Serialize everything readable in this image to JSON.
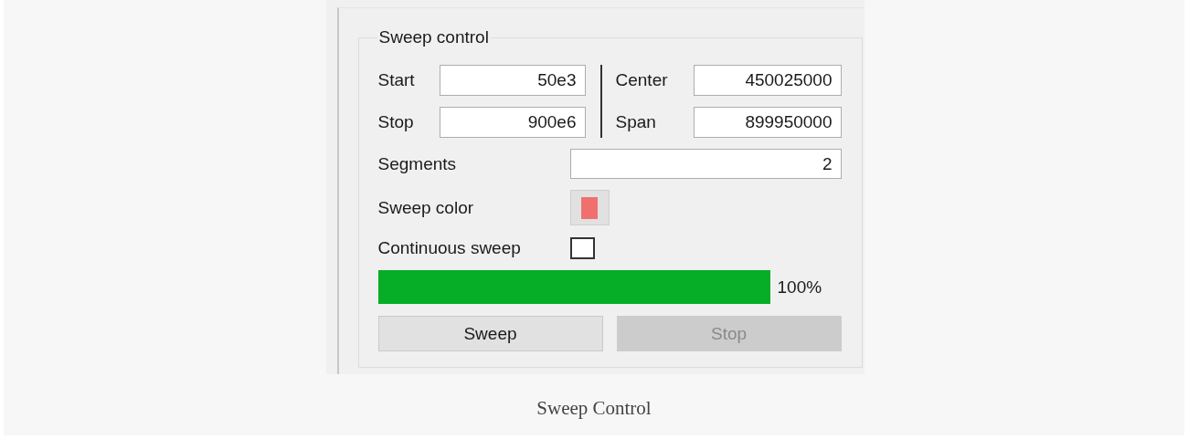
{
  "group": {
    "title": "Sweep control"
  },
  "fields": [
    {
      "label": "Start",
      "value": "50e3"
    },
    {
      "label": "Stop",
      "value": "900e6"
    },
    {
      "label": "Center",
      "value": "450025000"
    },
    {
      "label": "Span",
      "value": "899950000"
    }
  ],
  "segments": {
    "label": "Segments",
    "value": "2"
  },
  "sweep_color": {
    "label": "Sweep color",
    "color": "#f07070"
  },
  "continuous_sweep": {
    "label": "Continuous sweep",
    "checked": false
  },
  "progress": {
    "level": 1,
    "reading": "100%"
  },
  "buttons": [
    {
      "label": "Sweep",
      "disabled": false
    },
    {
      "label": "Stop",
      "disabled": true
    }
  ],
  "caption": "Sweep Control"
}
